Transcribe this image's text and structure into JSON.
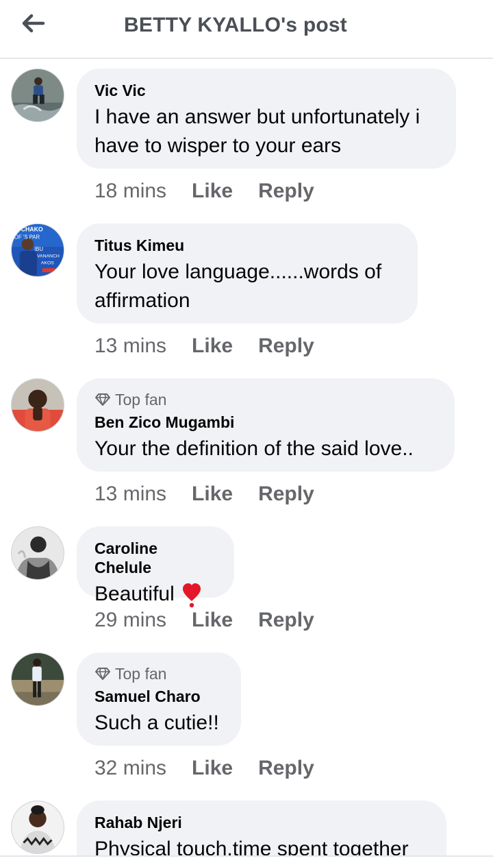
{
  "header": {
    "title": "BETTY KYALLO's post",
    "back_icon": "arrow-left-icon"
  },
  "comments": [
    {
      "author": "Vic Vic",
      "top_fan": "",
      "text": "I have an answer but unfortunately i have to wisper to your ears",
      "time": "18 mins",
      "like": "Like",
      "reply": "Reply"
    },
    {
      "author": "Titus Kimeu",
      "top_fan": "",
      "text": "Your love language......words of affirmation",
      "time": "13 mins",
      "like": "Like",
      "reply": "Reply"
    },
    {
      "author": "Ben Zico Mugambi",
      "top_fan": "Top fan",
      "text": "Your the definition of the said love..",
      "time": "13 mins",
      "like": "Like",
      "reply": "Reply"
    },
    {
      "author": "Caroline Chelule",
      "top_fan": "",
      "text": "Beautiful",
      "emoji": "heart-emoji",
      "time": "29 mins",
      "like": "Like",
      "reply": "Reply"
    },
    {
      "author": "Samuel Charo",
      "top_fan": "Top fan",
      "text": "Such a cutie!!",
      "time": "32 mins",
      "like": "Like",
      "reply": "Reply"
    },
    {
      "author": "Rahab Njeri",
      "top_fan": "",
      "text": "Physical touch,time spent together",
      "time": "",
      "like": "",
      "reply": ""
    }
  ],
  "avatar_texts": {
    "titus": [
      "CHAKO",
      "OF  'S PAR",
      "IBU",
      "VANANCH",
      "AKOS"
    ]
  },
  "colors": {
    "bubble": "#f0f2f5",
    "secondary_text": "#65676b",
    "title_text": "#4b4f56",
    "divider": "#e4e6eb",
    "heart": "#e4162a"
  }
}
